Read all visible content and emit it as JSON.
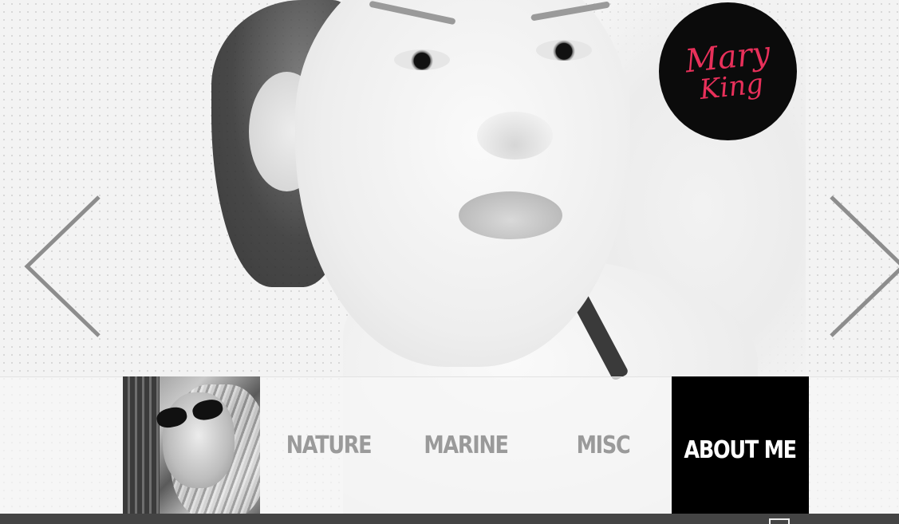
{
  "logo": {
    "line1": "Mary",
    "line2": "King"
  },
  "navigation": {
    "items": [
      {
        "label": "NATURE",
        "active": false
      },
      {
        "label": "MARINE",
        "active": false
      },
      {
        "label": "MISC",
        "active": false
      },
      {
        "label": "ABOUT ME",
        "active": true
      }
    ]
  },
  "icons": {
    "prev": "chevron-left-icon",
    "next": "chevron-right-icon",
    "fullscreen": "fullscreen-icon"
  },
  "colors": {
    "logo_background": "#0b0b0b",
    "logo_text": "#e8305a",
    "nav_active_background": "#000000",
    "nav_active_text": "#ffffff",
    "nav_text": "#9a9a9a",
    "footer": "#444444"
  }
}
